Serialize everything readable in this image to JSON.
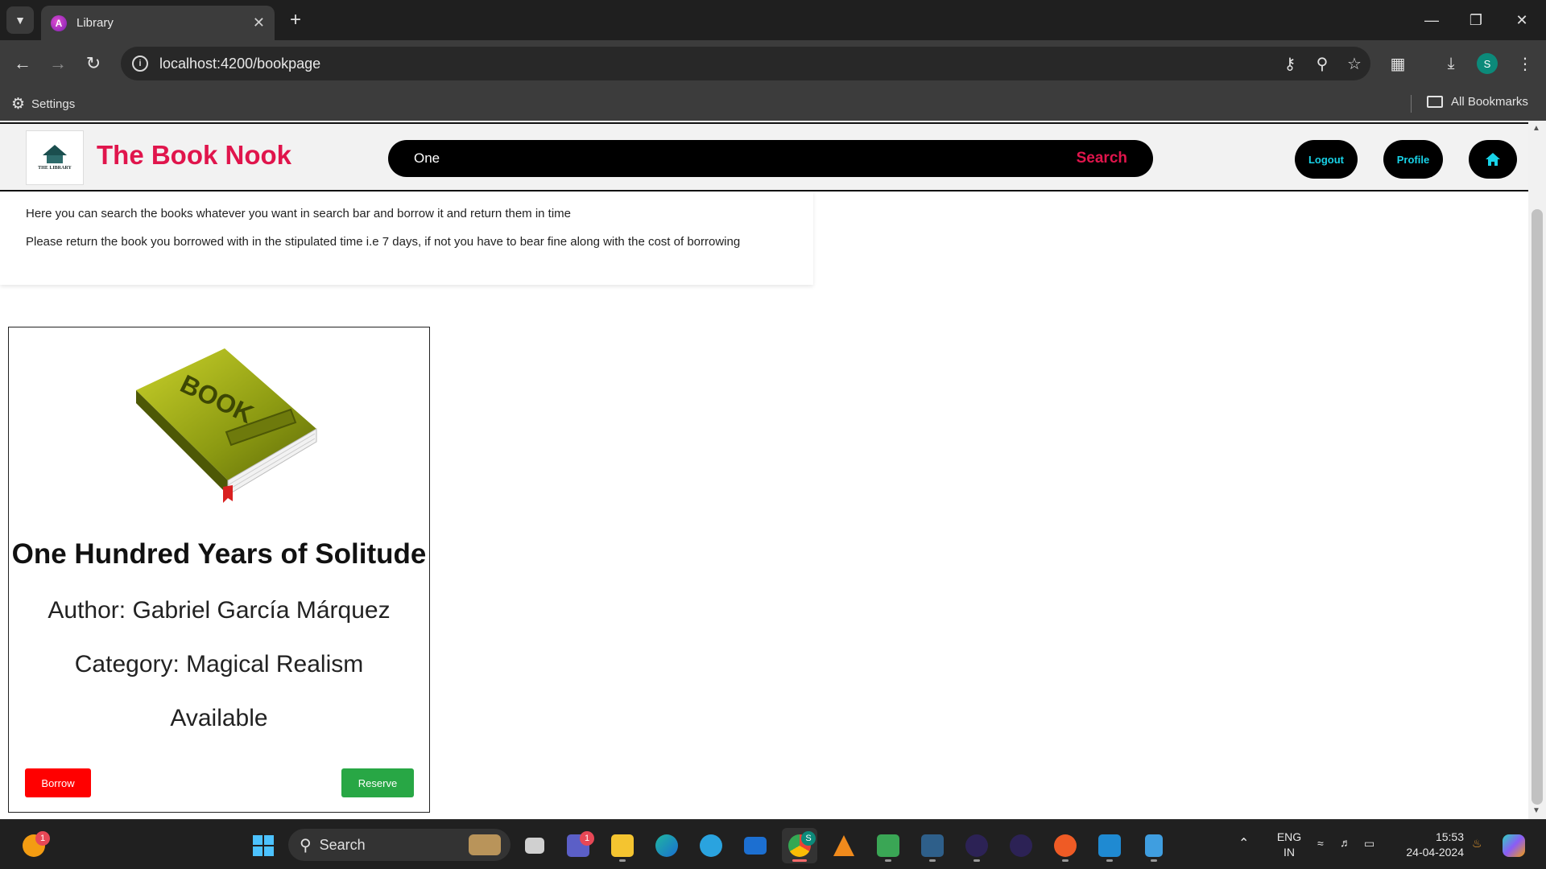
{
  "browser": {
    "tab_title": "Library",
    "url": "localhost:4200/bookpage",
    "bookmark_settings": "Settings",
    "all_bookmarks": "All Bookmarks",
    "profile_initial": "S"
  },
  "nav": {
    "brand": "The Book Nook",
    "logo_text": "THE LIBRARY",
    "search_value": "One",
    "search_button": "Search",
    "logout": "Logout",
    "profile": "Profile",
    "accent_color": "#e0154c",
    "pill_text_color": "#18d3e8"
  },
  "info": {
    "line1": "Here you can search the books whatever you want in search bar and borrow it and return them in time",
    "line2": "Please return the book you borrowed with in the stipulated time i.e 7 days, if not you have to bear fine along with the cost of borrowing"
  },
  "book": {
    "cover_text": "BOOK",
    "title": "One Hundred Years of Solitude",
    "author": "Author: Gabriel García Márquez",
    "category": "Category: Magical Realism",
    "status": "Available",
    "borrow_label": "Borrow",
    "reserve_label": "Reserve"
  },
  "taskbar": {
    "search_label": "Search",
    "lang_top": "ENG",
    "lang_bottom": "IN",
    "time": "15:53",
    "date": "24-04-2024",
    "teams_badge": "1",
    "corner_badge": "1",
    "chrome_badge": "S"
  }
}
